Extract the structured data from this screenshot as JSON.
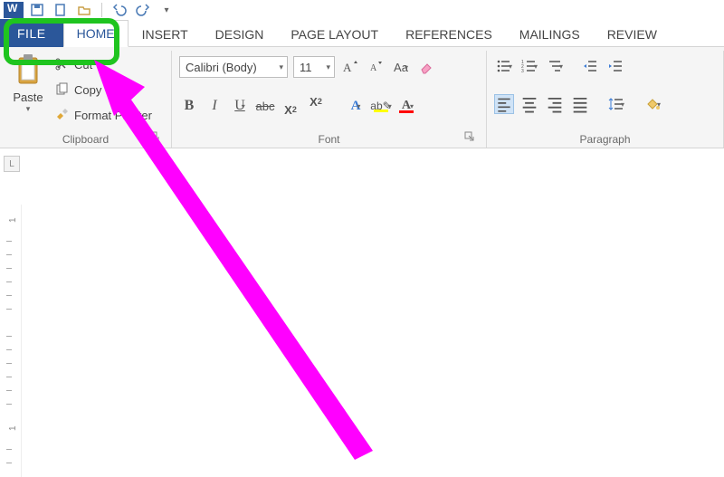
{
  "qat": {
    "undo_tooltip": "Undo",
    "redo_tooltip": "Redo"
  },
  "tabs": {
    "file": "FILE",
    "home": "HOME",
    "insert": "INSERT",
    "design": "DESIGN",
    "page_layout": "PAGE LAYOUT",
    "references": "REFERENCES",
    "mailings": "MAILINGS",
    "review": "REVIEW"
  },
  "ribbon": {
    "clipboard": {
      "label": "Clipboard",
      "paste": "Paste",
      "cut": "Cut",
      "copy": "Copy",
      "format_painter": "Format Painter"
    },
    "font": {
      "label": "Font",
      "font_name": "Calibri (Body)",
      "font_size": "11",
      "bold": "B",
      "italic": "I",
      "underline": "U",
      "strike": "abc",
      "subscript_base": "X",
      "subscript_sub": "2",
      "superscript_base": "X",
      "superscript_sup": "2",
      "case": "Aa",
      "highlight_color": "#ffff00",
      "font_color": "#ff0000",
      "font_glyph": "A"
    },
    "paragraph": {
      "label": "Paragraph"
    }
  },
  "ruler": {
    "corner": "L",
    "marks": [
      "1",
      "1"
    ]
  },
  "colors": {
    "word_blue": "#2b579a",
    "annotation_green": "#1fc41f",
    "annotation_magenta": "#ff00ff"
  }
}
